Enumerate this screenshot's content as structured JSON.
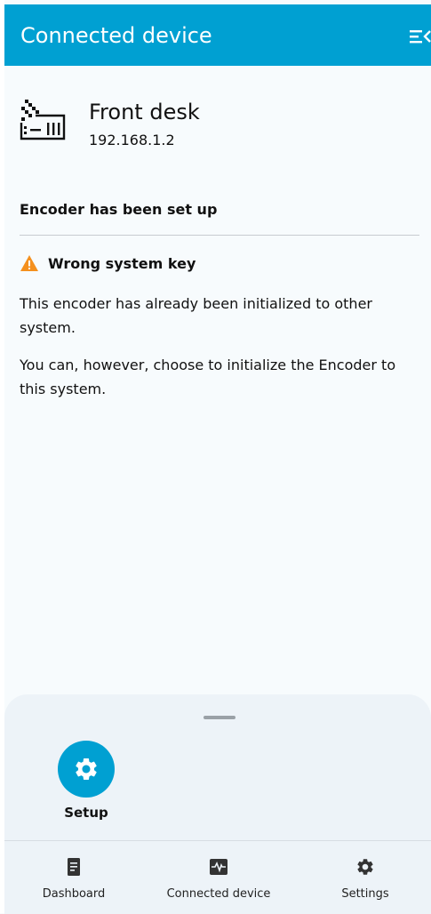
{
  "app_bar": {
    "title": "Connected device"
  },
  "device": {
    "name": "Front desk",
    "ip": "192.168.1.2"
  },
  "status": "Encoder has been set up",
  "warning": {
    "title": "Wrong system key",
    "paragraph_1": "This encoder has already been initialized to other system.",
    "paragraph_2": "You can, however, choose to initialize the Encoder to this system."
  },
  "sheet": {
    "setup_label": "Setup"
  },
  "nav": {
    "dashboard": "Dashboard",
    "connected_device": "Connected device",
    "settings": "Settings"
  },
  "colors": {
    "primary": "#00a0d2",
    "warning": "#f4901e",
    "surface": "#edf3f8"
  }
}
